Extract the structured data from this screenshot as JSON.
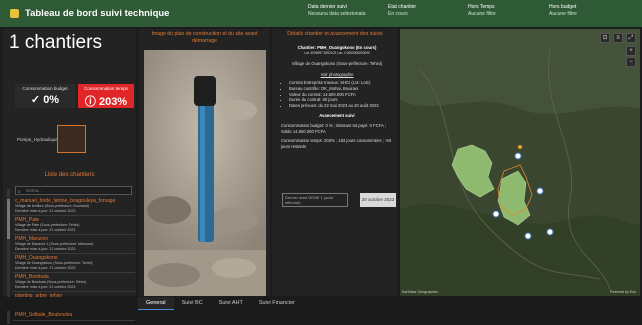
{
  "header": {
    "title": "Tableau de bord suivi technique",
    "info": [
      {
        "label": "Data dernier suivi",
        "value": "Nessuna data selezionata"
      },
      {
        "label": "Etat chantier",
        "value": "En cours"
      },
      {
        "label": "Hors Temps",
        "value": "Aucune filtre"
      },
      {
        "label": "Hors budget",
        "value": "Aucune filtre"
      }
    ]
  },
  "summary": {
    "count_label": "1 chantiers",
    "budget_label": "Consommation budget",
    "budget_value": "0%",
    "time_label": "Consommation temps",
    "time_value": "203%",
    "pin_label": "Pompe_Hydraulique"
  },
  "list": {
    "title": "Liste des chantiers",
    "search_placeholder": "Cerca...",
    "items": [
      {
        "name": "c_manuel_forde_latrine_bougouleya_forsage",
        "sub1": "Village de Ientibro (Sous-préfecture: Koumbal)",
        "sub2": "Dernière mise à jour: 21 octobre 2023"
      },
      {
        "name": "PMH_Pate",
        "sub1": "Village de Pate (Sous-préfecture: Tehini)",
        "sub2": "Dernière mise à jour: 21 octobre 2023"
      },
      {
        "name": "PMH_Manzoni",
        "sub1": "Village de Manzoni 1 (Sous-préfecture: Mamoue)",
        "sub2": "Dernière mise à jour: 21 octobre 2023"
      },
      {
        "name": "PMH_Ouangokono",
        "sub1": "Village de Ouangokono (Sous-préfecture: Tehini)",
        "sub2": "Dernière mise à jour: 21 octobre 2023"
      },
      {
        "name": "PMH_Bombala",
        "sub1": "Village de Bombala (Sous-préfecture: Tehini)",
        "sub2": "Dernière mise à jour: 21 octobre 2023"
      },
      {
        "name": "planting_arbre_tehini",
        "sub1": "Village de Huitadi (Sous-préfecture: Tehini)",
        "sub2": "Dernière mise à jour: 22 octobre 2023"
      },
      {
        "name": "PMH_Solbale_Bouboulou",
        "sub1": "",
        "sub2": ""
      }
    ]
  },
  "photo_panel": {
    "title": "Image du plan de construction et du site avant démarrage"
  },
  "details": {
    "title": "Détails chantier et avancement des suivis",
    "chantier": "Chantier: PMH_Ouangokono (En cours)",
    "coords": "Lat: 4006997.5392102  Lon: 0.0000000000000",
    "village": "Village de Ouangokono (Sous-préfecture: Tehini)",
    "link": "Voir photographie",
    "bullets": [
      "Contrat Entreprise travaux: SHCI (Lot: Lot1)",
      "Bureau contrôle: OK_Mohai, Bouirani",
      "Valeur du contrat: 14.500.000 FCFA",
      "Durée du contrat: 90 jours",
      "Dates prévues: du 22 mai 2023 au 20 août 2023"
    ],
    "avancement_title": "Avancement suivi",
    "budget_line": "Consommation budget: 0 % ;  Montant tot payé: 0 FCFA ; Solde 14.500.000 FCFA",
    "temps_line": "Consommation temps: 203% ; 183 jours consommées ; -93 jours restants",
    "last_btn": "Dernier suivi DENE 1 (suivi effectué)",
    "date_btn": "20 octobre 2023"
  },
  "map": {
    "attribution": "Earthstar Geographics",
    "powered": "Powered by Esri"
  },
  "tabs": [
    "General",
    "Suivi BC",
    "Suivi AHT",
    "Suivi Financier"
  ],
  "colors": {
    "header": "#2f5a36",
    "accent": "#e27a36",
    "alert": "#e02626"
  }
}
